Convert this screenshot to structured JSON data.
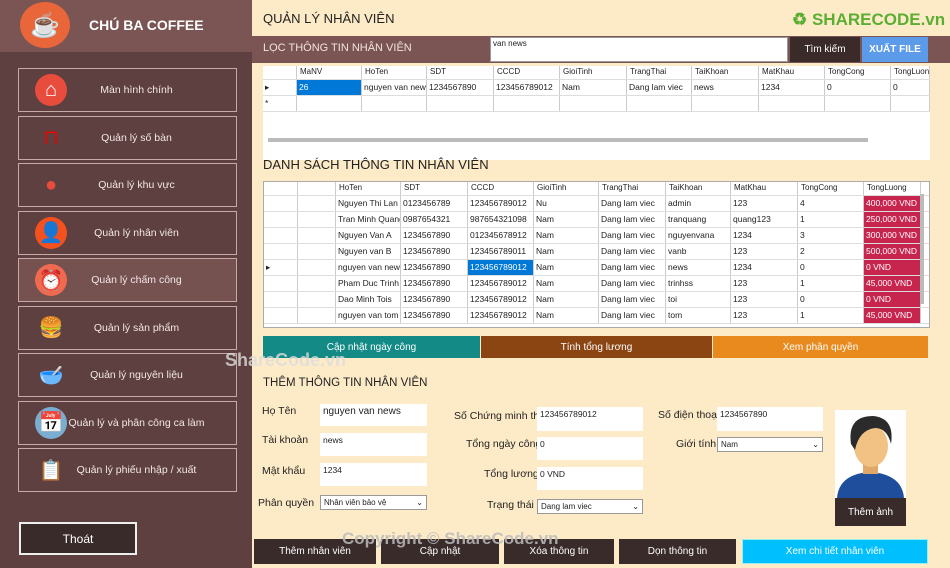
{
  "app": {
    "brand": "CHÚ BA COFFEE"
  },
  "sidebar": {
    "items": [
      {
        "label": "Màn hình chính",
        "icon": "home-icon"
      },
      {
        "label": "Quản lý số bàn",
        "icon": "table-icon"
      },
      {
        "label": "Quản lý khu vực",
        "icon": "location-pin-icon"
      },
      {
        "label": "Quản lý nhân viên",
        "icon": "user-icon"
      },
      {
        "label": "Quản lý chấm công",
        "icon": "alarm-clock-icon"
      },
      {
        "label": "Quản lý sản phẩm",
        "icon": "burger-drink-icon"
      },
      {
        "label": "Quản lý nguyên liệu",
        "icon": "ingredients-icon"
      },
      {
        "label": "Quản lý và phân công ca làm",
        "icon": "calendar-icon"
      },
      {
        "label": "Quản lý phiếu nhập / xuất",
        "icon": "clipboard-icon"
      }
    ],
    "exit": "Thoát"
  },
  "header": {
    "title": "QUẢN LÝ NHÂN VIÊN",
    "filter_label": "LỌC THÔNG TIN NHÂN VIÊN",
    "search_value": "van news",
    "search_button": "Tìm kiếm",
    "export_button": "XUẤT FILE"
  },
  "filter_grid": {
    "columns": [
      "MaNV",
      "HoTen",
      "SDT",
      "CCCD",
      "GioiTinh",
      "TrangThai",
      "TaiKhoan",
      "MatKhau",
      "TongCong",
      "TongLuon"
    ],
    "rows": [
      [
        "26",
        "nguyen van news",
        "1234567890",
        "123456789012",
        "Nam",
        "Dang lam viec",
        "news",
        "1234",
        "0",
        "0"
      ]
    ]
  },
  "list": {
    "title": "DANH SÁCH THÔNG TIN NHÂN VIÊN",
    "columns": [
      "",
      "HoTen",
      "SDT",
      "CCCD",
      "GioiTinh",
      "TrangThai",
      "TaiKhoan",
      "MatKhau",
      "TongCong",
      "TongLuong"
    ],
    "rows": [
      [
        "",
        "Nguyen Thi Lan",
        "0123456789",
        "123456789012",
        "Nu",
        "Dang lam viec",
        "admin",
        "123",
        "4",
        "400,000 VND"
      ],
      [
        "",
        "Tran Minh Quang",
        "0987654321",
        "987654321098",
        "Nam",
        "Dang lam viec",
        "tranquang",
        "quang123",
        "1",
        "250,000 VND"
      ],
      [
        "",
        "Nguyen Van A",
        "1234567890",
        "012345678912",
        "Nam",
        "Dang lam viec",
        "nguyenvana",
        "1234",
        "3",
        "300,000 VND"
      ],
      [
        "",
        "Nguyen van B",
        "1234567890",
        "123456789011",
        "Nam",
        "Dang lam viec",
        "vanb",
        "123",
        "2",
        "500,000 VND"
      ],
      [
        "",
        "nguyen van news",
        "1234567890",
        "123456789012",
        "Nam",
        "Dang lam viec",
        "news",
        "1234",
        "0",
        "0 VND"
      ],
      [
        "",
        "Pham Duc Trinh",
        "1234567890",
        "123456789012",
        "Nam",
        "Dang lam viec",
        "trinhss",
        "123",
        "1",
        "45,000 VND"
      ],
      [
        "",
        "Dao Minh Tois",
        "1234567890",
        "123456789012",
        "Nam",
        "Dang lam viec",
        "toi",
        "123",
        "0",
        "0 VND"
      ],
      [
        "",
        "nguyen van tom",
        "1234567890",
        "123456789012",
        "Nam",
        "Dang lam viec",
        "tom",
        "123",
        "1",
        "45,000 VND"
      ]
    ],
    "selected_row": 4,
    "buttons": [
      "Cập nhật ngày công",
      "Tính tổng lương",
      "Xem phân quyền"
    ]
  },
  "form": {
    "title": "THÊM THÔNG TIN NHÂN VIÊN",
    "hoten_label": "Họ Tên",
    "hoten": "nguyen van news",
    "taikhoan_label": "Tài khoản",
    "taikhoan": "news",
    "matkhau_label": "Mật khẩu",
    "matkhau": "1234",
    "phanquyen_label": "Phân quyền",
    "phanquyen": "Nhân viên bảo vệ",
    "cmt_label": "Số Chứng minh thư",
    "cmt": "123456789012",
    "ngaycong_label": "Tổng ngày công",
    "ngaycong": "0",
    "luong_label": "Tổng lương",
    "luong": "0 VND",
    "trangthai_label": "Trạng thái",
    "trangthai": "Dang lam viec",
    "sdt_label": "Số điện thoại",
    "sdt": "1234567890",
    "gioitinh_label": "Giới tính",
    "gioitinh": "Nam",
    "add_photo": "Thêm ảnh"
  },
  "actions": [
    "Thêm nhân viên",
    "Cập nhật",
    "Xóa thông tin",
    "Dọn thông tin",
    "Xem chi tiết nhân viên"
  ],
  "watermarks": {
    "logo": "SHARECODE.vn",
    "mid": "ShareCode.vn",
    "copyright": "Copyright © ShareCode.vn"
  },
  "colors": {
    "sidebar": "#5e4040",
    "accent_teal": "#138a85",
    "accent_brown": "#8b4513",
    "accent_orange": "#e88a1e",
    "accent_blue": "#00bfff",
    "salary_red": "#c8254e"
  }
}
